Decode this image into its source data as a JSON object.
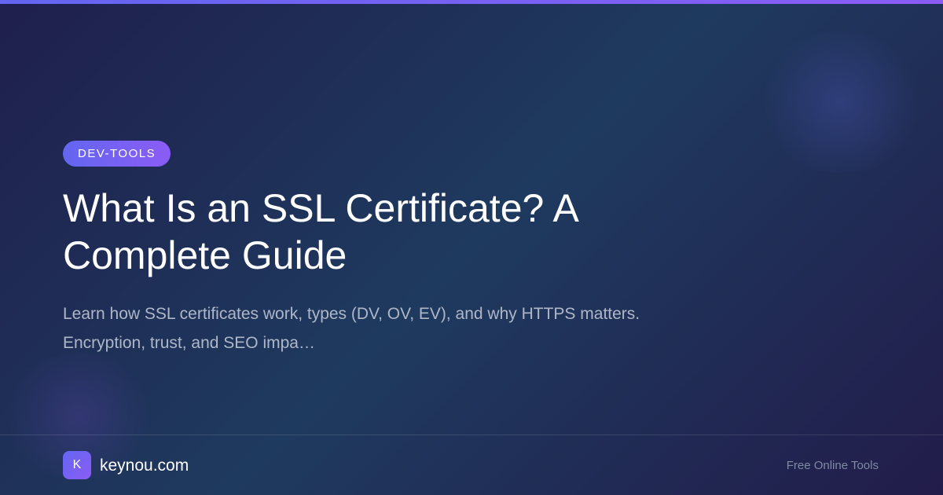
{
  "badge": "DEV-TOOLS",
  "title": "What Is an SSL Certificate? A Complete Guide",
  "description": "Learn how SSL certificates work, types (DV, OV, EV), and why HTTPS matters. Encryption, trust, and SEO impa…",
  "footer": {
    "logo_letter": "K",
    "site_name": "keynou.com",
    "tagline": "Free Online Tools"
  },
  "colors": {
    "accent_start": "#6366f1",
    "accent_end": "#8b5cf6",
    "background_start": "#1f1f4d",
    "background_mid": "#1f3a5f",
    "text_primary": "#ffffff",
    "text_secondary": "#aeb7c8",
    "text_muted": "#7f8aa3"
  }
}
